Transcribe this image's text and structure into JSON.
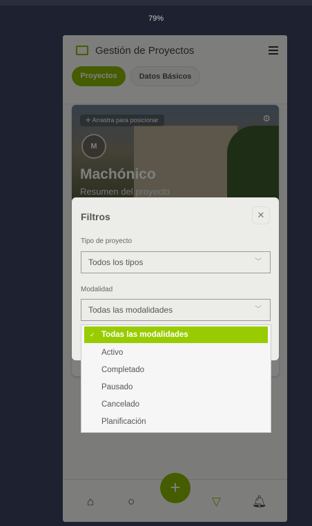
{
  "zoom_level": "79%",
  "header": {
    "title": "Gestión de Proyectos"
  },
  "tabs": [
    {
      "label": "Proyectos",
      "active": true
    },
    {
      "label": "Datos Básicos",
      "active": false
    }
  ],
  "project_card": {
    "drag_hint": "Arrastra para posicionar",
    "avatar_initial": "M",
    "name": "Machónico",
    "subtitle": "Resumen del proyecto"
  },
  "filter_modal": {
    "title": "Filtros",
    "close_icon": "close-icon",
    "project_type": {
      "label": "Tipo de proyecto",
      "value": "Todos los tipos"
    },
    "modality": {
      "label": "Modalidad",
      "value": "Todas las modalidades",
      "options": [
        "Todas las modalidades",
        "Activo",
        "Completado",
        "Pausado",
        "Cancelado",
        "Planificación"
      ],
      "selected": "Todas las modalidades"
    }
  },
  "bottom_nav": {
    "items": [
      "home-icon",
      "search-icon",
      "add-icon",
      "filter-icon",
      "bell-icon"
    ],
    "active": "filter-icon",
    "add_label": "+"
  },
  "colors": {
    "accent": "#99cc00",
    "background": "#1e2130"
  }
}
